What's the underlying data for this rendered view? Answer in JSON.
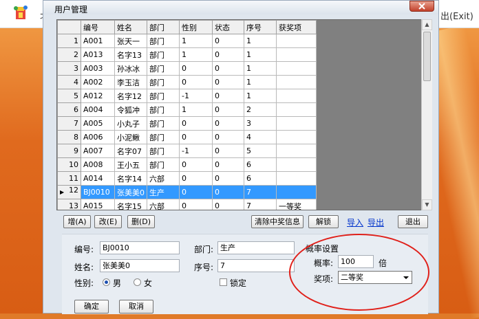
{
  "app": {
    "title": "北",
    "exit_text": "出(Exit)"
  },
  "dialog": {
    "title": "用户管理"
  },
  "grid": {
    "columns": [
      "编号",
      "姓名",
      "部门",
      "性别",
      "状态",
      "序号",
      "获奖项"
    ],
    "rows": [
      {
        "num": "1",
        "id": "A001",
        "name": "张天一",
        "dept": "部门",
        "gender": "1",
        "status": "0",
        "seq": "1",
        "award": ""
      },
      {
        "num": "2",
        "id": "A013",
        "name": "名字13",
        "dept": "部门",
        "gender": "1",
        "status": "0",
        "seq": "1",
        "award": ""
      },
      {
        "num": "3",
        "id": "A003",
        "name": "孙冰冰",
        "dept": "部门",
        "gender": "0",
        "status": "0",
        "seq": "1",
        "award": ""
      },
      {
        "num": "4",
        "id": "A002",
        "name": "李玉洁",
        "dept": "部门",
        "gender": "0",
        "status": "0",
        "seq": "1",
        "award": ""
      },
      {
        "num": "5",
        "id": "A012",
        "name": "名字12",
        "dept": "部门",
        "gender": "-1",
        "status": "0",
        "seq": "1",
        "award": ""
      },
      {
        "num": "6",
        "id": "A004",
        "name": "令狐冲",
        "dept": "部门",
        "gender": "1",
        "status": "0",
        "seq": "2",
        "award": ""
      },
      {
        "num": "7",
        "id": "A005",
        "name": "小丸子",
        "dept": "部门",
        "gender": "0",
        "status": "0",
        "seq": "3",
        "award": ""
      },
      {
        "num": "8",
        "id": "A006",
        "name": "小泥鳅",
        "dept": "部门",
        "gender": "0",
        "status": "0",
        "seq": "4",
        "award": ""
      },
      {
        "num": "9",
        "id": "A007",
        "name": "名字07",
        "dept": "部门",
        "gender": "-1",
        "status": "0",
        "seq": "5",
        "award": ""
      },
      {
        "num": "10",
        "id": "A008",
        "name": "王小五",
        "dept": "部门",
        "gender": "0",
        "status": "0",
        "seq": "6",
        "award": ""
      },
      {
        "num": "11",
        "id": "A014",
        "name": "名字14",
        "dept": "六部",
        "gender": "0",
        "status": "0",
        "seq": "6",
        "award": ""
      },
      {
        "num": "12",
        "id": "BJ0010",
        "name": "张美美0",
        "dept": "生产",
        "gender": "0",
        "status": "0",
        "seq": "7",
        "award": "",
        "selected": true
      },
      {
        "num": "13",
        "id": "A015",
        "name": "名字15",
        "dept": "六部",
        "gender": "0",
        "status": "0",
        "seq": "7",
        "award": "一等奖"
      }
    ]
  },
  "toolbar": {
    "add_label": "增(A)",
    "edit_label": "改(E)",
    "delete_label": "删(D)",
    "clear_label": "清除中奖信息",
    "unlock_label": "解锁",
    "import_label": "导入",
    "export_label": "导出",
    "exit_label": "退出"
  },
  "form": {
    "id_label": "编号:",
    "id_value": "BJ0010",
    "name_label": "姓名:",
    "name_value": "张美美0",
    "gender_label": "性别:",
    "male_label": "男",
    "female_label": "女",
    "gender_selected": "男",
    "dept_label": "部门:",
    "dept_value": "生产",
    "seq_label": "序号:",
    "seq_value": "7",
    "lock_label": "锁定",
    "lock_checked": false,
    "ok_label": "确定",
    "cancel_label": "取消"
  },
  "probability": {
    "group_label": "概率设置",
    "rate_label": "概率:",
    "rate_value": "100",
    "rate_unit": "倍",
    "award_label": "奖项:",
    "award_value": "二等奖"
  },
  "colors": {
    "selection": "#3399ff",
    "annotation_circle": "#e0201a",
    "background": "#e07a28"
  }
}
